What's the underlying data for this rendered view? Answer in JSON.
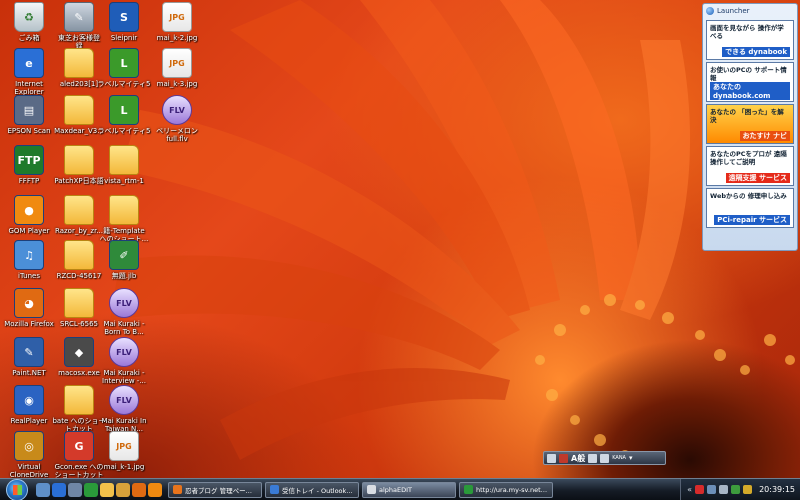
{
  "desktop": {
    "icons": [
      {
        "label": "ごみ箱",
        "icon": "recycle-bin-icon",
        "kind": "recycle",
        "glyph": "♻",
        "color": ""
      },
      {
        "label": "Internet\nExplorer",
        "icon": "internet-explorer-icon",
        "kind": "app",
        "glyph": "e",
        "color": "#2a6fd6"
      },
      {
        "label": "EPSON Scan",
        "icon": "scanner-icon",
        "kind": "app",
        "glyph": "▤",
        "color": "#5a6a86"
      },
      {
        "label": "FFFTP",
        "icon": "ffftp-icon",
        "kind": "app",
        "glyph": "FTP",
        "color": "#1f7a2b"
      },
      {
        "label": "GOM Player",
        "icon": "gom-player-icon",
        "kind": "app",
        "glyph": "●",
        "color": "#f08a10"
      },
      {
        "label": "iTunes",
        "icon": "itunes-icon",
        "kind": "app",
        "glyph": "♫",
        "color": "#4b8fd8"
      },
      {
        "label": "Mozilla Firefox",
        "icon": "firefox-icon",
        "kind": "app",
        "glyph": "◕",
        "color": "#e06a12"
      },
      {
        "label": "Paint.NET",
        "icon": "paint-net-icon",
        "kind": "app",
        "glyph": "✎",
        "color": "#2f5fa8"
      },
      {
        "label": "RealPlayer",
        "icon": "realplayer-icon",
        "kind": "app",
        "glyph": "◉",
        "color": "#2b63c2"
      },
      {
        "label": "Virtual\nCloneDrive",
        "icon": "virtual-clonedrive-icon",
        "kind": "app",
        "glyph": "◎",
        "color": "#c88a1a"
      },
      {
        "label": "東芝お客様登\n録",
        "icon": "registration-icon",
        "kind": "shortcut",
        "glyph": "✎",
        "color": ""
      },
      {
        "label": "aled203[1]",
        "icon": "folder-icon",
        "kind": "folder",
        "glyph": "",
        "color": ""
      },
      {
        "label": "Maxdear_V3...",
        "icon": "folder-icon",
        "kind": "folder",
        "glyph": "",
        "color": ""
      },
      {
        "label": "PatchXP日本語",
        "icon": "folder-icon",
        "kind": "folder",
        "glyph": "",
        "color": ""
      },
      {
        "label": "Razor_by_zr...",
        "icon": "folder-icon",
        "kind": "folder",
        "glyph": "",
        "color": ""
      },
      {
        "label": "RZCD-45617",
        "icon": "folder-icon",
        "kind": "folder",
        "glyph": "",
        "color": ""
      },
      {
        "label": "SRCL-6565",
        "icon": "folder-icon",
        "kind": "folder",
        "glyph": "",
        "color": ""
      },
      {
        "label": "macosx.exe",
        "icon": "executable-icon",
        "kind": "app",
        "glyph": "◆",
        "color": "#4a4a4a"
      },
      {
        "label": "bate へのショー\nトカット",
        "icon": "folder-shortcut-icon",
        "kind": "folder",
        "glyph": "",
        "color": ""
      },
      {
        "label": "Gcon.exe への\nショートカット",
        "icon": "gcon-icon",
        "kind": "app",
        "glyph": "G",
        "color": "#d43a2a"
      },
      {
        "label": "Sleipnir",
        "icon": "sleipnir-icon",
        "kind": "app",
        "glyph": "S",
        "color": "#1f5db8"
      },
      {
        "label": "ラベルマイティ5",
        "icon": "label-mighty-icon",
        "kind": "app",
        "glyph": "L",
        "color": "#3b9a2a"
      },
      {
        "label": "ラベルマイティ5",
        "icon": "label-mighty-icon",
        "kind": "app",
        "glyph": "L",
        "color": "#3b9a2a"
      },
      {
        "label": "vista_rtm-1",
        "icon": "folder-icon",
        "kind": "folder",
        "glyph": "",
        "color": ""
      },
      {
        "label": "籍-Template\nへのショート...",
        "icon": "folder-shortcut-icon",
        "kind": "folder",
        "glyph": "",
        "color": ""
      },
      {
        "label": "無題.jlb",
        "icon": "jlb-file-icon",
        "kind": "app",
        "glyph": "✐",
        "color": "#2f8a3a"
      },
      {
        "label": "Mai Kuraki -\nBorn To B...",
        "icon": "flv-video-icon",
        "kind": "video",
        "glyph": "FLV",
        "color": ""
      },
      {
        "label": "Mai Kuraki -\nInterview -...",
        "icon": "flv-video-icon",
        "kind": "video",
        "glyph": "FLV",
        "color": ""
      },
      {
        "label": "Mai Kuraki In\nTaiwan N...",
        "icon": "flv-video-icon",
        "kind": "video",
        "glyph": "FLV",
        "color": ""
      },
      {
        "label": "mai_k-1.jpg",
        "icon": "image-file-icon",
        "kind": "image",
        "glyph": "JPG",
        "color": ""
      },
      {
        "label": "mai_k-2.jpg",
        "icon": "image-file-icon",
        "kind": "image",
        "glyph": "JPG",
        "color": ""
      },
      {
        "label": "mai_k-3.jpg",
        "icon": "image-file-icon",
        "kind": "image",
        "glyph": "JPG",
        "color": ""
      },
      {
        "label": "ベリーメロン\nfull.flv",
        "icon": "flv-video-icon",
        "kind": "video",
        "glyph": "FLV",
        "color": ""
      }
    ]
  },
  "launcher": {
    "title": "Launcher",
    "items": [
      {
        "text": "画面を見ながら\n操作が学べる",
        "brand": "できる dynabook",
        "tone": "blue"
      },
      {
        "text": "お使いのPCの\nサポート情報",
        "brand": "あなたの dynabook.com",
        "tone": "blue"
      },
      {
        "text": "あなたの\n「困った」を解決",
        "brand": "おたすけ ナビ",
        "tone": "orange"
      },
      {
        "text": "あなたのPCをプロが\n遠隔操作してご説明",
        "brand": "遠隔支援 サービス",
        "tone": "red"
      },
      {
        "text": "Webからの\n修理申し込み",
        "brand": "PCi-repair サービス",
        "tone": "blue"
      }
    ]
  },
  "language_bar": {
    "ime_mode": "A般",
    "kana": "KANA"
  },
  "taskbar": {
    "tasks": [
      {
        "label": "忍者ブログ 管理ページ...",
        "icon": "browser-icon",
        "active": false
      },
      {
        "label": "受信トレイ - Outlook E...",
        "icon": "mail-icon",
        "active": false
      },
      {
        "label": "alphaEDIT",
        "icon": "editor-icon",
        "active": true
      },
      {
        "label": "http://ura.my-sv.net/ ...",
        "icon": "sleipnir-icon",
        "active": false
      }
    ],
    "clock": "20:39:15"
  }
}
